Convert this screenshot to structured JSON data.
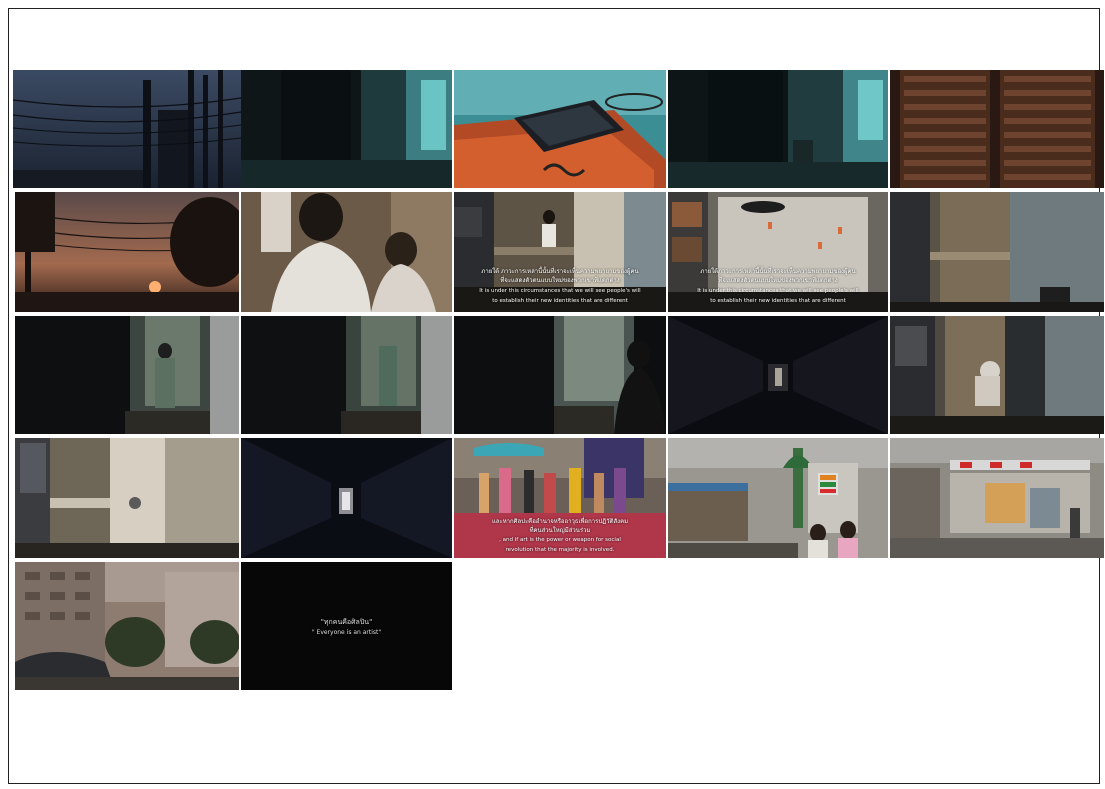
{
  "sheet": {
    "title": "",
    "tiles": [
      {
        "id": 1,
        "scene": "power-lines-dusk"
      },
      {
        "id": 2,
        "scene": "dark-doorway-teal"
      },
      {
        "id": 3,
        "scene": "phone-on-book"
      },
      {
        "id": 4,
        "scene": "dark-doorway-teal-2"
      },
      {
        "id": 5,
        "scene": "wooden-shutters"
      },
      {
        "id": 6,
        "scene": "sunset-power-lines"
      },
      {
        "id": 7,
        "scene": "people-in-room"
      },
      {
        "id": 8,
        "scene": "kitchen-fridge-subtitled"
      },
      {
        "id": 9,
        "scene": "calendar-wall-subtitled"
      },
      {
        "id": 10,
        "scene": "kitchen-corner"
      },
      {
        "id": 11,
        "scene": "dark-door-person"
      },
      {
        "id": 12,
        "scene": "dark-door-plants"
      },
      {
        "id": 13,
        "scene": "silhouette-window"
      },
      {
        "id": 14,
        "scene": "dark-corridor"
      },
      {
        "id": 15,
        "scene": "kitchen-bent-figure"
      },
      {
        "id": 16,
        "scene": "kitchen-door"
      },
      {
        "id": 17,
        "scene": "dark-corridor-light"
      },
      {
        "id": 18,
        "scene": "street-market-subtitled"
      },
      {
        "id": 19,
        "scene": "seven-eleven-store"
      },
      {
        "id": 20,
        "scene": "street-shop-front"
      },
      {
        "id": 21,
        "scene": "apartment-street"
      },
      {
        "id": 22,
        "scene": "title-card"
      }
    ]
  },
  "subtitles": {
    "t8_thai_1": "ภายใต้ ภาวะการเหล่านี้นั้นที่เราจะเห็นความพยายามของผู้คน",
    "t8_thai_2": "ที่จะแสดงตัวตนแบบใหม่ของพวกเขาที่แตกต่าง",
    "t8_en_1": "It is under this circumstances that we will see people's will",
    "t8_en_2": "to establish their new identities that are different",
    "t9_thai_1": "ภายใต้ภาวะการเหล่านี้นั้นที่เราจะเห็นความพยายามของผู้คน",
    "t9_thai_2": "ที่จะแสดงตัวตนแบบใหม่ของพวกเขาที่แตกต่าง",
    "t9_en_1": "It is under this circumstances that we will see people's will",
    "t9_en_2": "to establish their new identities that are different",
    "t18_thai_1": "และหากศิลปะคืออำนาจหรืออาวุธเพื่อการปฏิวัติสังคม",
    "t18_thai_2": "ที่คนส่วนใหญ่มีส่วนร่วม",
    "t18_en_1": ", and if art is the power or weapon for social",
    "t18_en_2": "revolution that the majority is involved.",
    "t22_thai": "\"ทุกคนคือศิลปิน\"",
    "t22_en": "\" Everyone is an artist\""
  },
  "colors": {
    "border": "#222222",
    "background": "#ffffff",
    "subtitle": "#ffffff"
  }
}
